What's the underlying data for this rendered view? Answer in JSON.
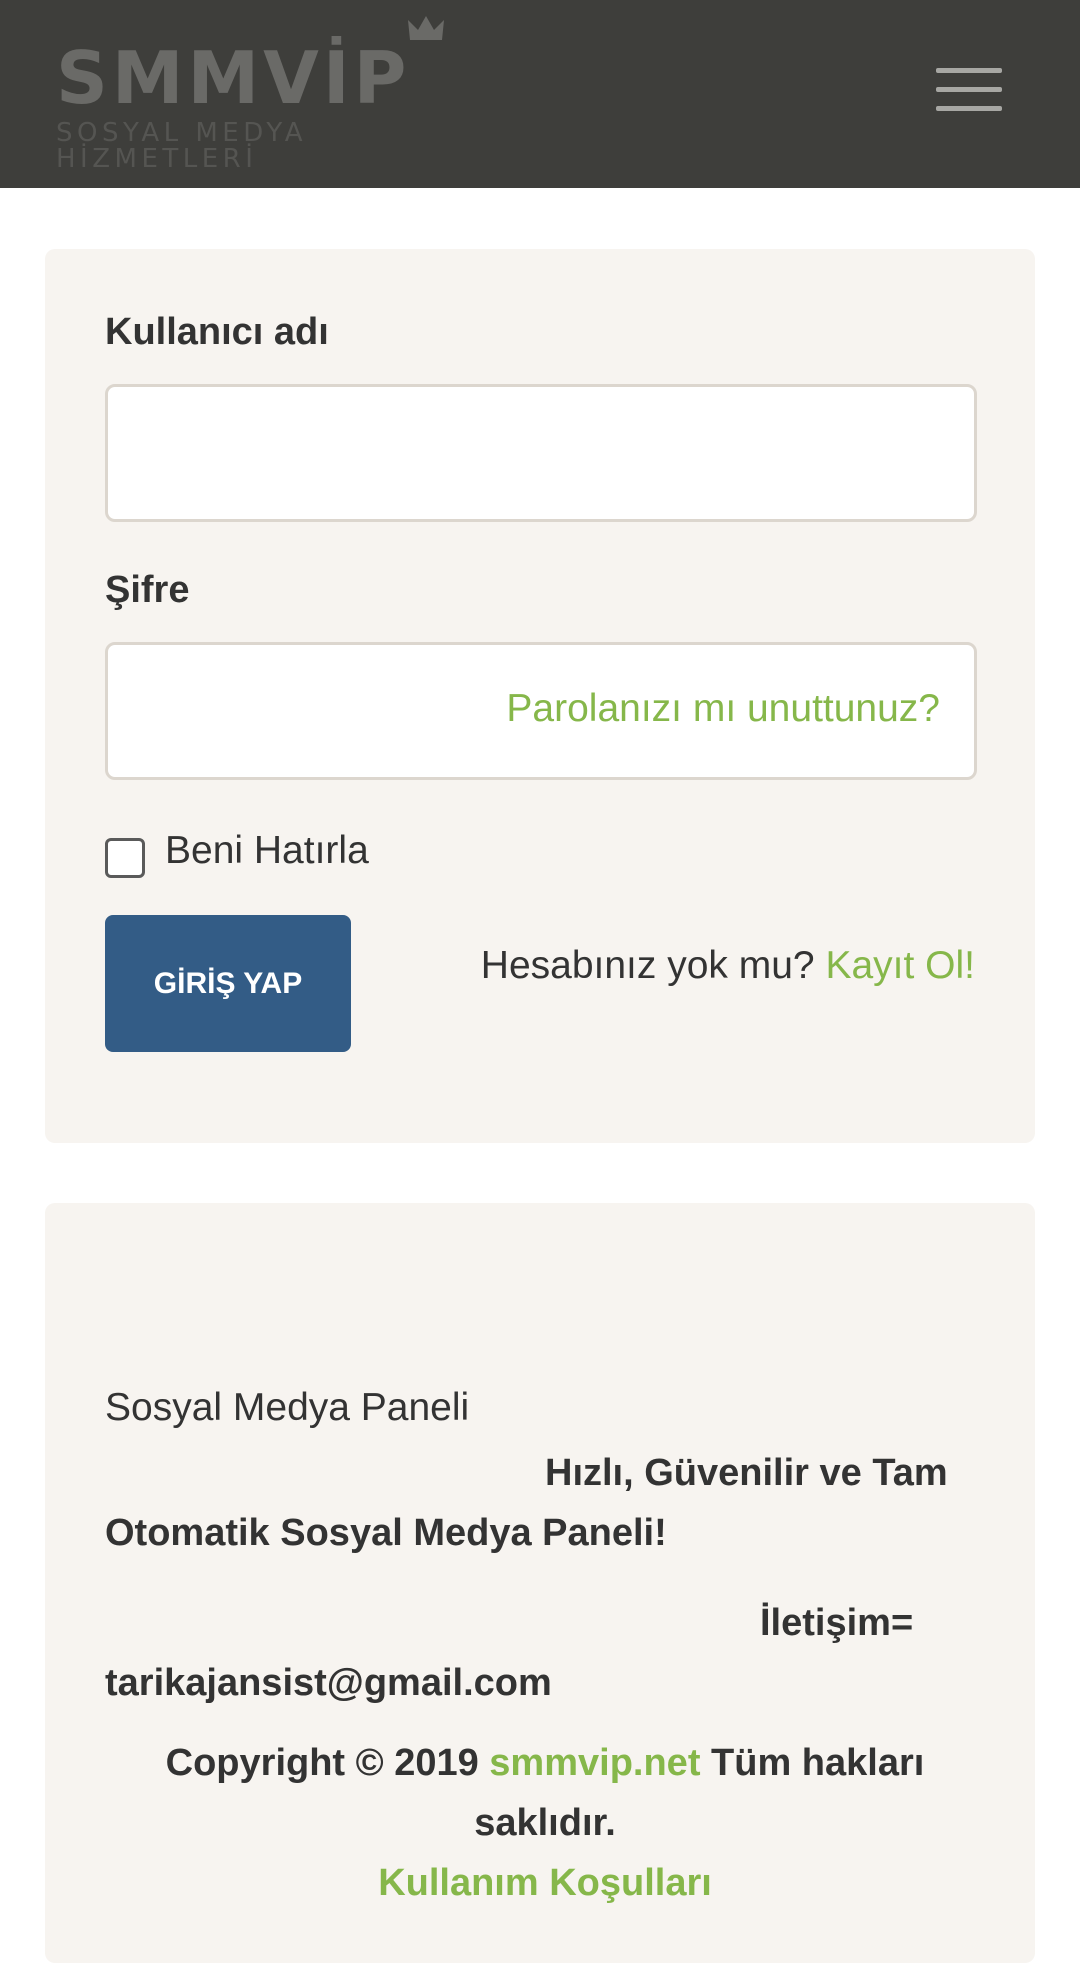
{
  "header": {
    "logo_text": "SMMVİP",
    "logo_subtitle": "SOSYAL MEDYA HİZMETLERİ",
    "menu_icon": "hamburger-menu-icon",
    "background_color": "#3e3e3b"
  },
  "login": {
    "username_label": "Kullanıcı adı",
    "username_value": "",
    "password_label": "Şifre",
    "password_value": "",
    "forgot_password_link": "Parolanızı mı unuttunuz?",
    "remember_me_label": "Beni Hatırla",
    "remember_me_checked": false,
    "submit_button": "GİRİŞ YAP",
    "no_account_text": "Hesabınız yok mu?",
    "register_link": "Kayıt Ol!"
  },
  "footer": {
    "title": "Sosyal Medya Paneli",
    "tagline": "Hızlı, Güvenilir ve Tam Otomatik Sosyal Medya Paneli!",
    "contact": "İletişim= tarikajansist@gmail.com",
    "copyright_prefix": "Copyright © 2019",
    "copyright_link": "smmvip.net",
    "copyright_suffix": "Tüm hakları saklıdır.",
    "terms_link": "Kullanım Koşulları"
  },
  "colors": {
    "accent_green": "#86b74a",
    "button_blue": "#335c86",
    "card_background": "#f7f4f0"
  }
}
